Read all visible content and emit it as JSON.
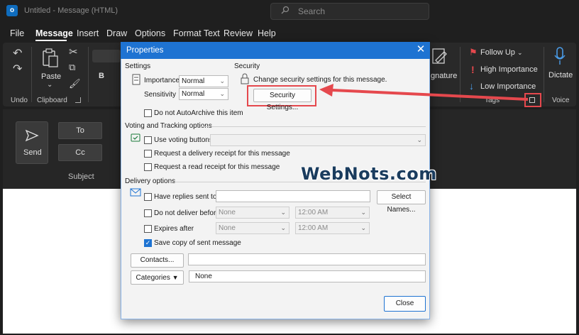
{
  "window": {
    "title": "Untitled - Message (HTML)",
    "app_badge": "o",
    "search_placeholder": "Search"
  },
  "menu": [
    "File",
    "Message",
    "Insert",
    "Draw",
    "Options",
    "Format Text",
    "Review",
    "Help"
  ],
  "ribbon": {
    "groups": {
      "undo": "Undo",
      "clipboard": "Clipboard",
      "tags": "Tags",
      "voice": "Voice"
    },
    "paste": "Paste",
    "bold_letter": "B",
    "signature": "gnature",
    "follow_up": "Follow Up",
    "high_importance": "High Importance",
    "low_importance": "Low Importance",
    "dictate": "Dictate"
  },
  "compose": {
    "send": "Send",
    "to": "To",
    "cc": "Cc",
    "subject": "Subject"
  },
  "dialog": {
    "title": "Properties",
    "settings_label": "Settings",
    "importance_label": "Importance",
    "importance_value": "Normal",
    "sensitivity_label": "Sensitivity",
    "sensitivity_value": "Normal",
    "security_label": "Security",
    "security_text": "Change security settings for this message.",
    "security_button": "Security Settings...",
    "autoarchive": "Do not AutoArchive this item",
    "voting_section": "Voting and Tracking options",
    "use_voting": "Use voting buttons",
    "delivery_receipt": "Request a delivery receipt for this message",
    "read_receipt": "Request a read receipt for this message",
    "delivery_section": "Delivery options",
    "replies_to": "Have replies sent to",
    "select_names": "Select Names...",
    "do_not_deliver": "Do not deliver before",
    "expires_after": "Expires after",
    "date_none": "None",
    "time_value": "12:00 AM",
    "save_copy": "Save copy of sent message",
    "contacts": "Contacts...",
    "categories": "Categories",
    "categories_value": "None",
    "close": "Close"
  },
  "watermark": "WebNots.com",
  "colors": {
    "accent": "#1e73d2",
    "highlight": "#e5484d",
    "flag": "#e5484d"
  }
}
